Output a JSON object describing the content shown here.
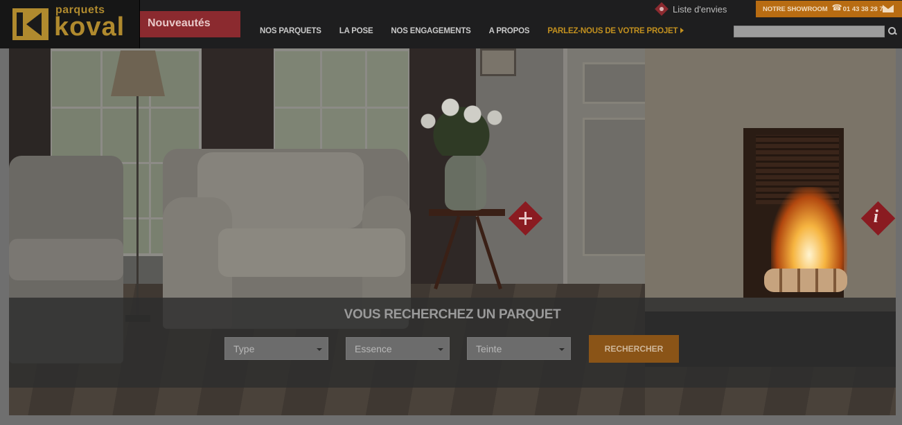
{
  "brand": {
    "logo_small": "parquets",
    "logo_big": "koval"
  },
  "header": {
    "new_label": "Nouveautés",
    "wishlist_label": "Liste d'envies",
    "showroom_label": "NOTRE SHOWROOM",
    "phone": "01 43 38 28 78",
    "search_placeholder": ""
  },
  "nav": {
    "items": [
      {
        "label": "NOS PARQUETS"
      },
      {
        "label": "LA POSE"
      },
      {
        "label": "NOS ENGAGEMENTS"
      },
      {
        "label": "A PROPOS"
      },
      {
        "label": "PARLEZ-NOUS DE VOTRE PROJET"
      }
    ]
  },
  "search": {
    "title": "VOUS RECHERCHEZ UN PARQUET",
    "type": "Type",
    "essence": "Essence",
    "teinte": "Teinte",
    "button": "RECHERCHER"
  },
  "icons": {
    "hotspot_info": "i"
  },
  "colors": {
    "accent_orange": "#b86c12",
    "accent_red": "#8b2a2f",
    "brand_gold": "#b08a2e"
  }
}
